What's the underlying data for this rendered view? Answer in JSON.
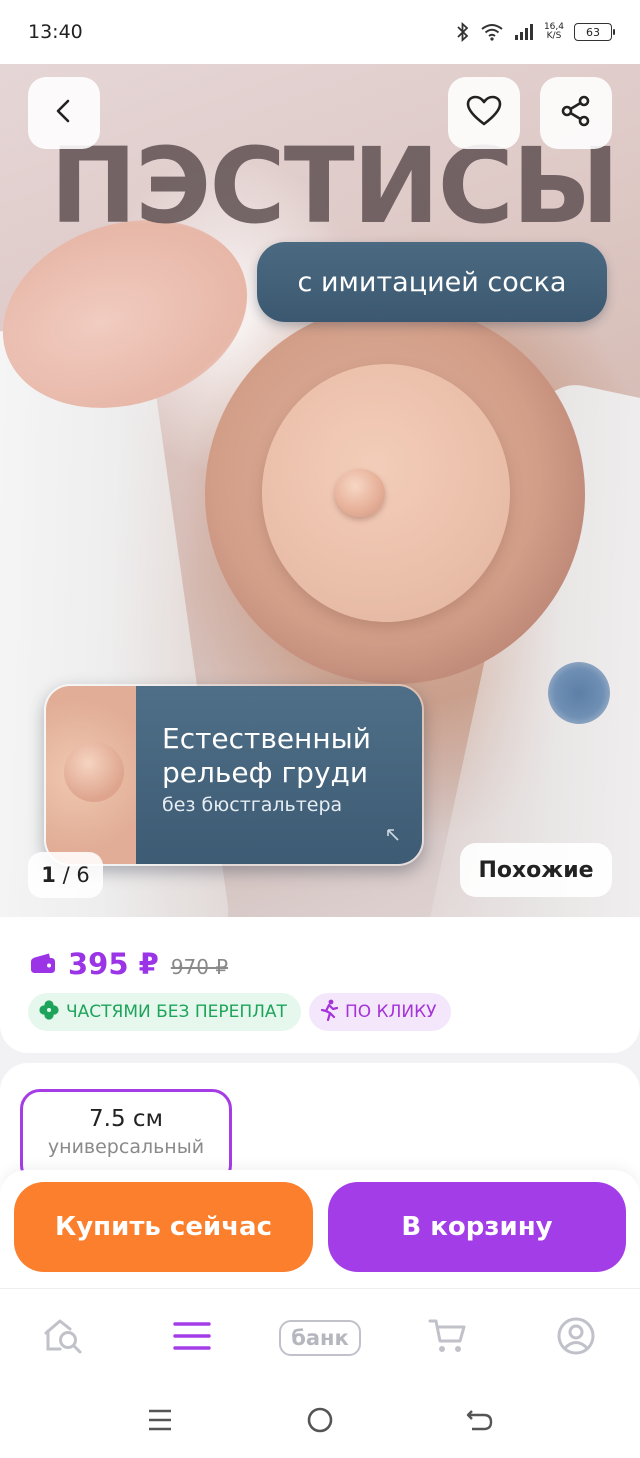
{
  "status_bar": {
    "time": "13:40",
    "net_speed_value": "16,4",
    "net_speed_unit": "K/S",
    "battery": "63"
  },
  "hero": {
    "title": "ПЭСТИСЫ",
    "pill_text": "с имитацией соска",
    "card_heading_line1": "Естественный",
    "card_heading_line2": "рельеф груди",
    "card_subtext": "без бюстгальтера",
    "counter_current": "1",
    "counter_total": "/ 6",
    "similar_label": "Похожие"
  },
  "price": {
    "current": "395 ₽",
    "old": "970 ₽",
    "badges": [
      {
        "label": "ЧАСТЯМИ БЕЗ ПЕРЕПЛАТ",
        "icon": "clover-icon",
        "color": "#1ea45a"
      },
      {
        "label": "ПО КЛИКУ",
        "icon": "running-person-icon",
        "color": "#a533d9"
      }
    ]
  },
  "size": {
    "selected_value": "7.5 см",
    "selected_sub": "универсальный"
  },
  "actions": {
    "buy_now": "Купить сейчас",
    "add_to_cart": "В корзину"
  },
  "bottom_nav": {
    "items": [
      {
        "name": "home",
        "icon": "home-search-icon"
      },
      {
        "name": "catalog",
        "icon": "menu-icon",
        "active": true
      },
      {
        "name": "bank",
        "label": "банк"
      },
      {
        "name": "cart",
        "icon": "cart-icon"
      },
      {
        "name": "profile",
        "icon": "profile-icon"
      }
    ]
  },
  "colors": {
    "accent_purple": "#a33de7",
    "accent_orange": "#fb7f2c",
    "badge_green": "#1ea45a"
  }
}
